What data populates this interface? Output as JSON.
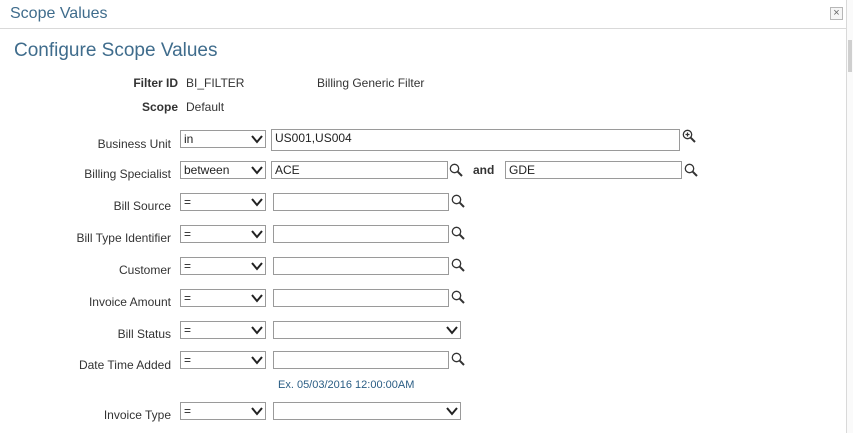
{
  "window": {
    "title": "Scope Values",
    "close_glyph": "×"
  },
  "heading": "Configure Scope Values",
  "filter": {
    "id_label": "Filter ID",
    "id_value": "BI_FILTER",
    "description": "Billing Generic Filter",
    "scope_label": "Scope",
    "scope_value": "Default"
  },
  "fields": {
    "business_unit": {
      "label": "Business Unit",
      "operator": "in",
      "value": "US001,US004"
    },
    "billing_specialist": {
      "label": "Billing Specialist",
      "operator": "between",
      "value_from": "ACE",
      "and_label": "and",
      "value_to": "GDE"
    },
    "bill_source": {
      "label": "Bill Source",
      "operator": "=",
      "value": ""
    },
    "bill_type_identifier": {
      "label": "Bill Type Identifier",
      "operator": "=",
      "value": ""
    },
    "customer": {
      "label": "Customer",
      "operator": "=",
      "value": ""
    },
    "invoice_amount": {
      "label": "Invoice Amount",
      "operator": "=",
      "value": ""
    },
    "bill_status": {
      "label": "Bill Status",
      "operator": "=",
      "value": ""
    },
    "date_time_added": {
      "label": "Date Time Added",
      "operator": "=",
      "value": "",
      "hint": "Ex. 05/03/2016 12:00:00AM"
    },
    "invoice_type": {
      "label": "Invoice Type",
      "operator": "=",
      "value": ""
    }
  },
  "icons": {
    "lookup": "magnifier-icon",
    "multi_lookup": "magnifier-plus-icon",
    "dropdown": "chevron-down-icon",
    "close": "close-icon"
  }
}
